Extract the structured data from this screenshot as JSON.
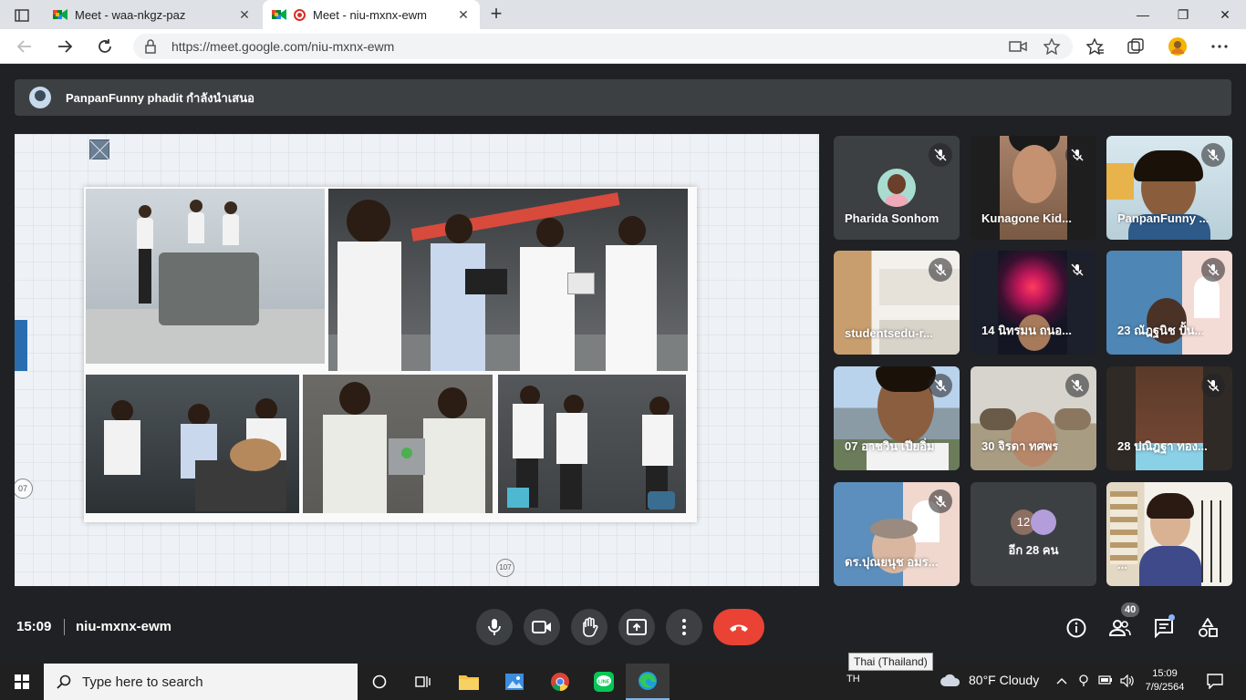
{
  "browser": {
    "tabs": [
      {
        "title": "Meet - waa-nkgz-paz",
        "close": "✕"
      },
      {
        "title": "Meet - niu-mxnx-ewm",
        "close": "✕"
      }
    ],
    "new_tab": "+",
    "url": "https://meet.google.com/niu-mxnx-ewm",
    "window_controls": {
      "minimize": "—",
      "maximize": "❐",
      "close": "✕"
    }
  },
  "meet": {
    "presenting_text": "PanpanFunny phadit กำลังนำเสนอ",
    "slide": {
      "badge_left": "07",
      "badge_bottom": "107"
    },
    "participants": [
      {
        "name": "Pharida Sonhom"
      },
      {
        "name": "Kunagone Kid..."
      },
      {
        "name": "PanpanFunny ..."
      },
      {
        "name": "studentsedu-r..."
      },
      {
        "name": "14 นิทรมน ถนอ..."
      },
      {
        "name": "23 ณัฎฐนิช ปั้น..."
      },
      {
        "name": "07 อาชวิน เปียอิ่ม"
      },
      {
        "name": "30 จิรดา ทศพร"
      },
      {
        "name": "28 ปณิฎฐา ทอง..."
      },
      {
        "name": "ดร.ปุณยนุช อมร..."
      },
      {
        "more_count": "12",
        "more_text": "อีก 28 คน"
      },
      {
        "name": "..."
      }
    ],
    "controls": {
      "time": "15:09",
      "meeting_code": "niu-mxnx-ewm",
      "participant_count": "40"
    }
  },
  "taskbar": {
    "search_placeholder": "Type here to search",
    "tooltip": "Thai (Thailand)",
    "language": "TH",
    "weather": "80°F  Cloudy",
    "time": "15:09",
    "date": "7/9/2564"
  },
  "colors": {
    "meet_bg": "#202124",
    "tile_bg": "#3c4043",
    "end_call": "#ea4335",
    "accent_blue": "#8ab4f8"
  }
}
